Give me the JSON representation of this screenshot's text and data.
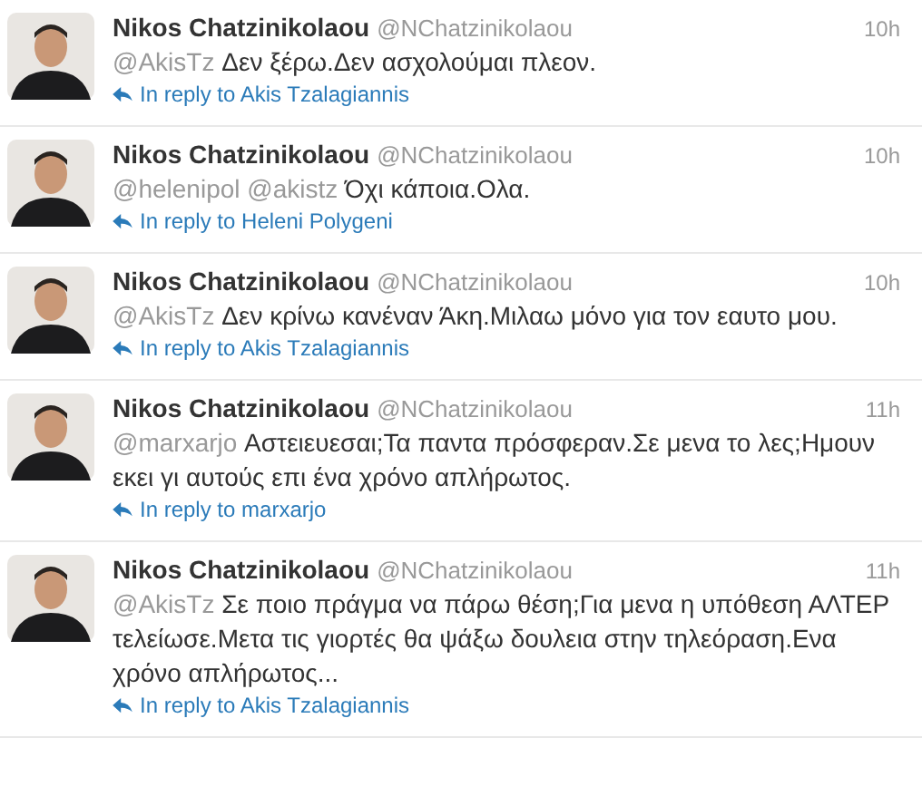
{
  "tweets": [
    {
      "name": "Nikos Chatzinikolaou",
      "handle": "@NChatzinikolaou",
      "time": "10h",
      "mentions": "@AkisTz",
      "text": "Δεν ξέρω.Δεν ασχολούμαι πλεον.",
      "reply": "In reply to Akis Tzalagiannis"
    },
    {
      "name": "Nikos Chatzinikolaou",
      "handle": "@NChatzinikolaou",
      "time": "10h",
      "mentions": "@helenipol @akistz",
      "text": "Όχι κάποια.Ολα.",
      "reply": "In reply to Heleni Polygeni"
    },
    {
      "name": "Nikos Chatzinikolaou",
      "handle": "@NChatzinikolaou",
      "time": "10h",
      "mentions": "@AkisTz",
      "text": "Δεν κρίνω κανέναν Άκη.Μιλαω μόνο για τον εαυτο μου.",
      "reply": "In reply to Akis Tzalagiannis"
    },
    {
      "name": "Nikos Chatzinikolaou",
      "handle": "@NChatzinikolaou",
      "time": "11h",
      "mentions": "@marxarjo",
      "text": "Αστειευεσαι;Τα παντα πρόσφεραν.Σε μενα το λες;Ημουν εκει γι αυτούς επι ένα χρόνο απλήρωτος.",
      "reply": "In reply to marxarjo"
    },
    {
      "name": "Nikos Chatzinikolaou",
      "handle": "@NChatzinikolaou",
      "time": "11h",
      "mentions": "@AkisTz",
      "text": "Σε ποιο πράγμα να πάρω θέση;Για μενα η υπόθεση ΑΛΤΕΡ τελείωσε.Μετα τις γιορτές θα ψάξω δουλεια στην τηλεόραση.Ενα χρόνο απλήρωτος...",
      "reply": "In reply to Akis Tzalagiannis"
    }
  ]
}
